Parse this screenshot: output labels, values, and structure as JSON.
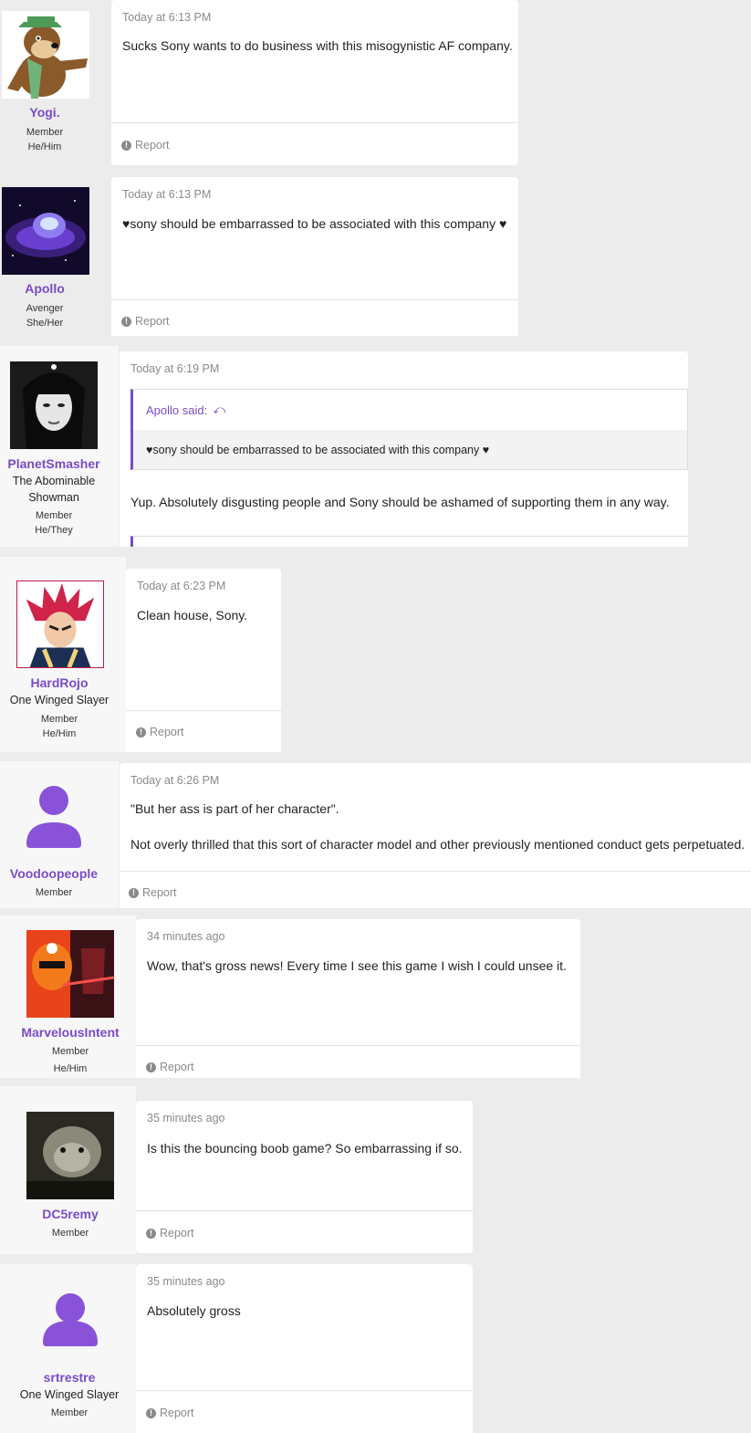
{
  "posts": [
    {
      "username": "Yogi.",
      "titles": [],
      "badges": [
        "Member",
        "He/Him"
      ],
      "time": "Today at 6:13 PM",
      "messages": [
        "Sucks Sony wants to do business with this misogynistic AF company."
      ],
      "report": "Report",
      "avatar": "cartoon-bear-avatar"
    },
    {
      "username": "Apollo",
      "titles": [],
      "badges": [
        "Avenger",
        "She/Her"
      ],
      "time": "Today at 6:13 PM",
      "messages": [
        "♥sony should be embarrassed to be associated with this company ♥"
      ],
      "report": "Report",
      "avatar": "galaxy-avatar"
    },
    {
      "username": "PlanetSmasher",
      "titles": [
        "The Abominable",
        "Showman"
      ],
      "badges": [
        "Member",
        "He/They"
      ],
      "time": "Today at 6:19 PM",
      "quote": {
        "author": "Apollo said:",
        "text": "♥sony should be embarrassed to be associated with this company ♥"
      },
      "messages": [
        "Yup. Absolutely disgusting people and Sony should be ashamed of supporting them in any way."
      ],
      "avatar": "portrait-avatar"
    },
    {
      "username": "HardRojo",
      "titles": [
        "One Winged Slayer"
      ],
      "badges": [
        "Member",
        "He/Him"
      ],
      "time": "Today at 6:23 PM",
      "messages": [
        "Clean house, Sony."
      ],
      "report": "Report",
      "avatar": "anime-avatar"
    },
    {
      "username": "Voodoopeople",
      "titles": [],
      "badges": [
        "Member"
      ],
      "time": "Today at 6:26 PM",
      "messages": [
        "\"But her ass is part of her character\".",
        "Not overly thrilled that this sort of character model and other previously mentioned conduct gets perpetuated."
      ],
      "report": "Report",
      "avatar": "default-user-avatar"
    },
    {
      "username": "MarvelousIntent",
      "titles": [],
      "badges": [
        "Member",
        "He/Him"
      ],
      "time": "34 minutes ago",
      "messages": [
        "Wow, that's gross news! Every time I see this game I wish I could unsee it."
      ],
      "report": "Report",
      "avatar": "ranger-avatar"
    },
    {
      "username": "DC5remy",
      "titles": [],
      "badges": [
        "Member"
      ],
      "time": "35 minutes ago",
      "messages": [
        "Is this the bouncing boob game? So embarrassing if so."
      ],
      "report": "Report",
      "avatar": "creature-avatar"
    },
    {
      "username": "srtrestre",
      "titles": [
        "One Winged Slayer"
      ],
      "badges": [
        "Member"
      ],
      "time": "35 minutes ago",
      "messages": [
        "Absolutely gross"
      ],
      "report": "Report",
      "avatar": "default-user-avatar"
    }
  ],
  "colors": {
    "accent": "#7b4bc4",
    "page_bg": "#ececec",
    "card_bg": "#ffffff",
    "user_col_bg": "#f7f7f7",
    "muted": "#8a8a8a"
  }
}
